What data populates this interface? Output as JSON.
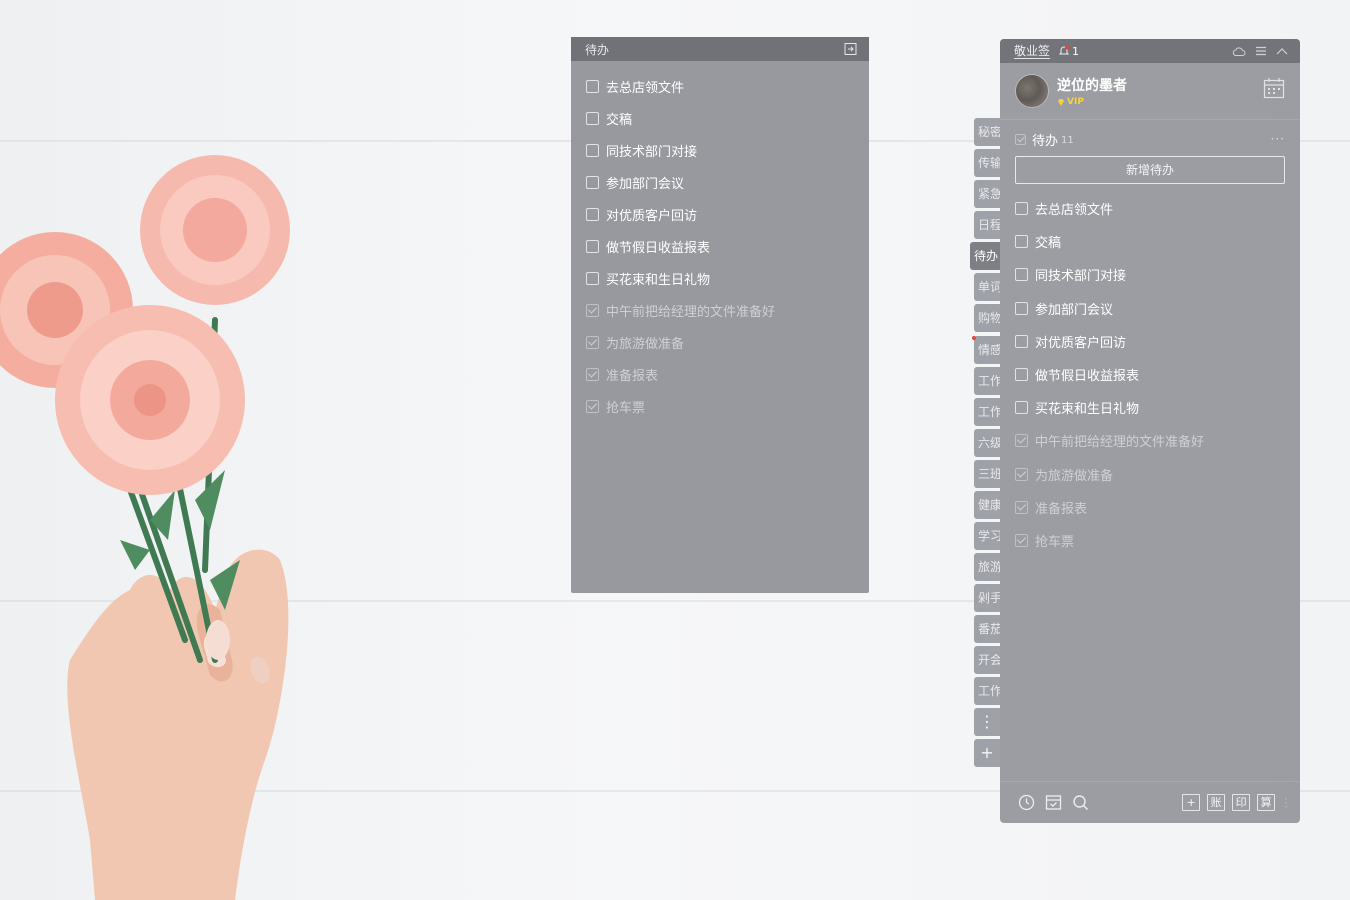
{
  "float_note": {
    "title": "待办",
    "exit_icon": "exit-icon",
    "items": [
      {
        "text": "去总店领文件",
        "done": false
      },
      {
        "text": "交稿",
        "done": false
      },
      {
        "text": "同技术部门对接",
        "done": false
      },
      {
        "text": "参加部门会议",
        "done": false
      },
      {
        "text": "对优质客户回访",
        "done": false
      },
      {
        "text": "做节假日收益报表",
        "done": false
      },
      {
        "text": "买花束和生日礼物",
        "done": false
      },
      {
        "text": "中午前把给经理的文件准备好",
        "done": true
      },
      {
        "text": "为旅游做准备",
        "done": true
      },
      {
        "text": "准备报表",
        "done": true
      },
      {
        "text": "抢车票",
        "done": true
      }
    ]
  },
  "side_tabs": {
    "tabs": [
      "秘密",
      "传输",
      "紧急",
      "日程",
      "待办",
      "单词",
      "购物",
      "情感",
      "工作",
      "工作",
      "六级",
      "三班",
      "健康",
      "学习",
      "旅游",
      "剁手",
      "番茄",
      "开会",
      "工作"
    ],
    "active_index": 4,
    "more_icon": "⋮",
    "add_icon": "+"
  },
  "panel": {
    "app_name": "敬业签",
    "notification_count": "1",
    "user": {
      "name": "逆位的墨者",
      "badge": "VIP"
    },
    "section": {
      "title": "待办",
      "count": "11",
      "more": "···"
    },
    "add_button": "新增待办",
    "items": [
      {
        "text": "去总店领文件",
        "done": false
      },
      {
        "text": "交稿",
        "done": false
      },
      {
        "text": "同技术部门对接",
        "done": false
      },
      {
        "text": "参加部门会议",
        "done": false
      },
      {
        "text": "对优质客户回访",
        "done": false
      },
      {
        "text": "做节假日收益报表",
        "done": false
      },
      {
        "text": "买花束和生日礼物",
        "done": false
      },
      {
        "text": "中午前把给经理的文件准备好",
        "done": true
      },
      {
        "text": "为旅游做准备",
        "done": true
      },
      {
        "text": "准备报表",
        "done": true
      },
      {
        "text": "抢车票",
        "done": true
      }
    ],
    "bottom_buttons": [
      "+",
      "账",
      "印",
      "算"
    ]
  }
}
